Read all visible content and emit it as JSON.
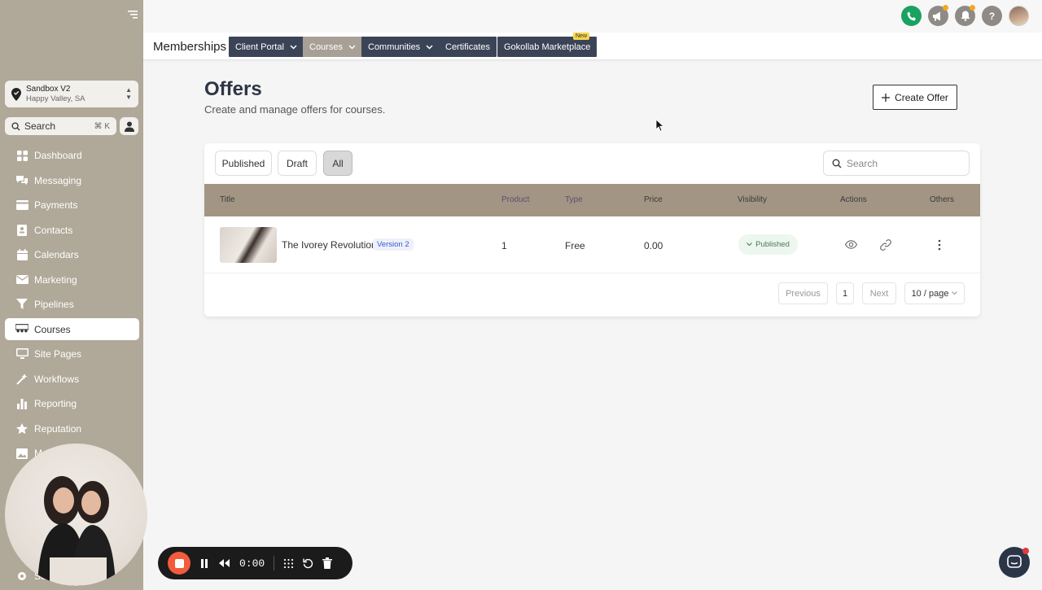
{
  "sidebar": {
    "location": {
      "name": "Sandbox V2",
      "place": "Happy Valley, SA"
    },
    "search": {
      "label": "Search",
      "shortcut": "⌘ K"
    },
    "items": [
      {
        "label": "Dashboard",
        "icon": "dashboard-icon"
      },
      {
        "label": "Messaging",
        "icon": "chat-icon"
      },
      {
        "label": "Payments",
        "icon": "payments-icon"
      },
      {
        "label": "Contacts",
        "icon": "contacts-icon"
      },
      {
        "label": "Calendars",
        "icon": "calendar-icon"
      },
      {
        "label": "Marketing",
        "icon": "mail-icon"
      },
      {
        "label": "Pipelines",
        "icon": "filter-icon"
      },
      {
        "label": "Courses",
        "icon": "people-icon"
      },
      {
        "label": "Site Pages",
        "icon": "monitor-icon"
      },
      {
        "label": "Workflows",
        "icon": "wand-icon"
      },
      {
        "label": "Reporting",
        "icon": "chart-icon"
      },
      {
        "label": "Reputation",
        "icon": "star-icon"
      },
      {
        "label": "M",
        "icon": "image-icon"
      }
    ],
    "settings_label": "Se",
    "active": "Courses"
  },
  "topbar": {
    "icons": [
      "phone-icon",
      "megaphone-icon",
      "bell-icon",
      "help-icon",
      "avatar"
    ],
    "help_glyph": "?",
    "colors": {
      "phone": "#1aa260",
      "gray": "#8f8a85"
    }
  },
  "subnav": {
    "title": "Memberships",
    "tabs": [
      {
        "label": "Client Portal",
        "has_dropdown": true
      },
      {
        "label": "Courses",
        "has_dropdown": true,
        "active": true
      },
      {
        "label": "Communities",
        "has_dropdown": true
      },
      {
        "label": "Certificates",
        "has_dropdown": false
      },
      {
        "label": "Gokollab Marketplace",
        "has_dropdown": false,
        "badge": "New"
      }
    ]
  },
  "main": {
    "title": "Offers",
    "subtitle": "Create and manage offers for courses.",
    "create_button": "Create Offer",
    "filters": [
      "Published",
      "Draft",
      "All"
    ],
    "active_filter": "All",
    "search_placeholder": "Search",
    "table": {
      "columns": [
        "Title",
        "Product",
        "Type",
        "Price",
        "Visibility",
        "Actions",
        "Others"
      ],
      "rows": [
        {
          "title": "The Ivorey Revolution",
          "version": "Version 2",
          "product": "1",
          "type": "Free",
          "price": "0.00",
          "visibility": "Published"
        }
      ]
    },
    "pagination": {
      "previous": "Previous",
      "page": "1",
      "next": "Next",
      "page_size": "10 / page"
    }
  },
  "recorder": {
    "time": "0:00"
  }
}
